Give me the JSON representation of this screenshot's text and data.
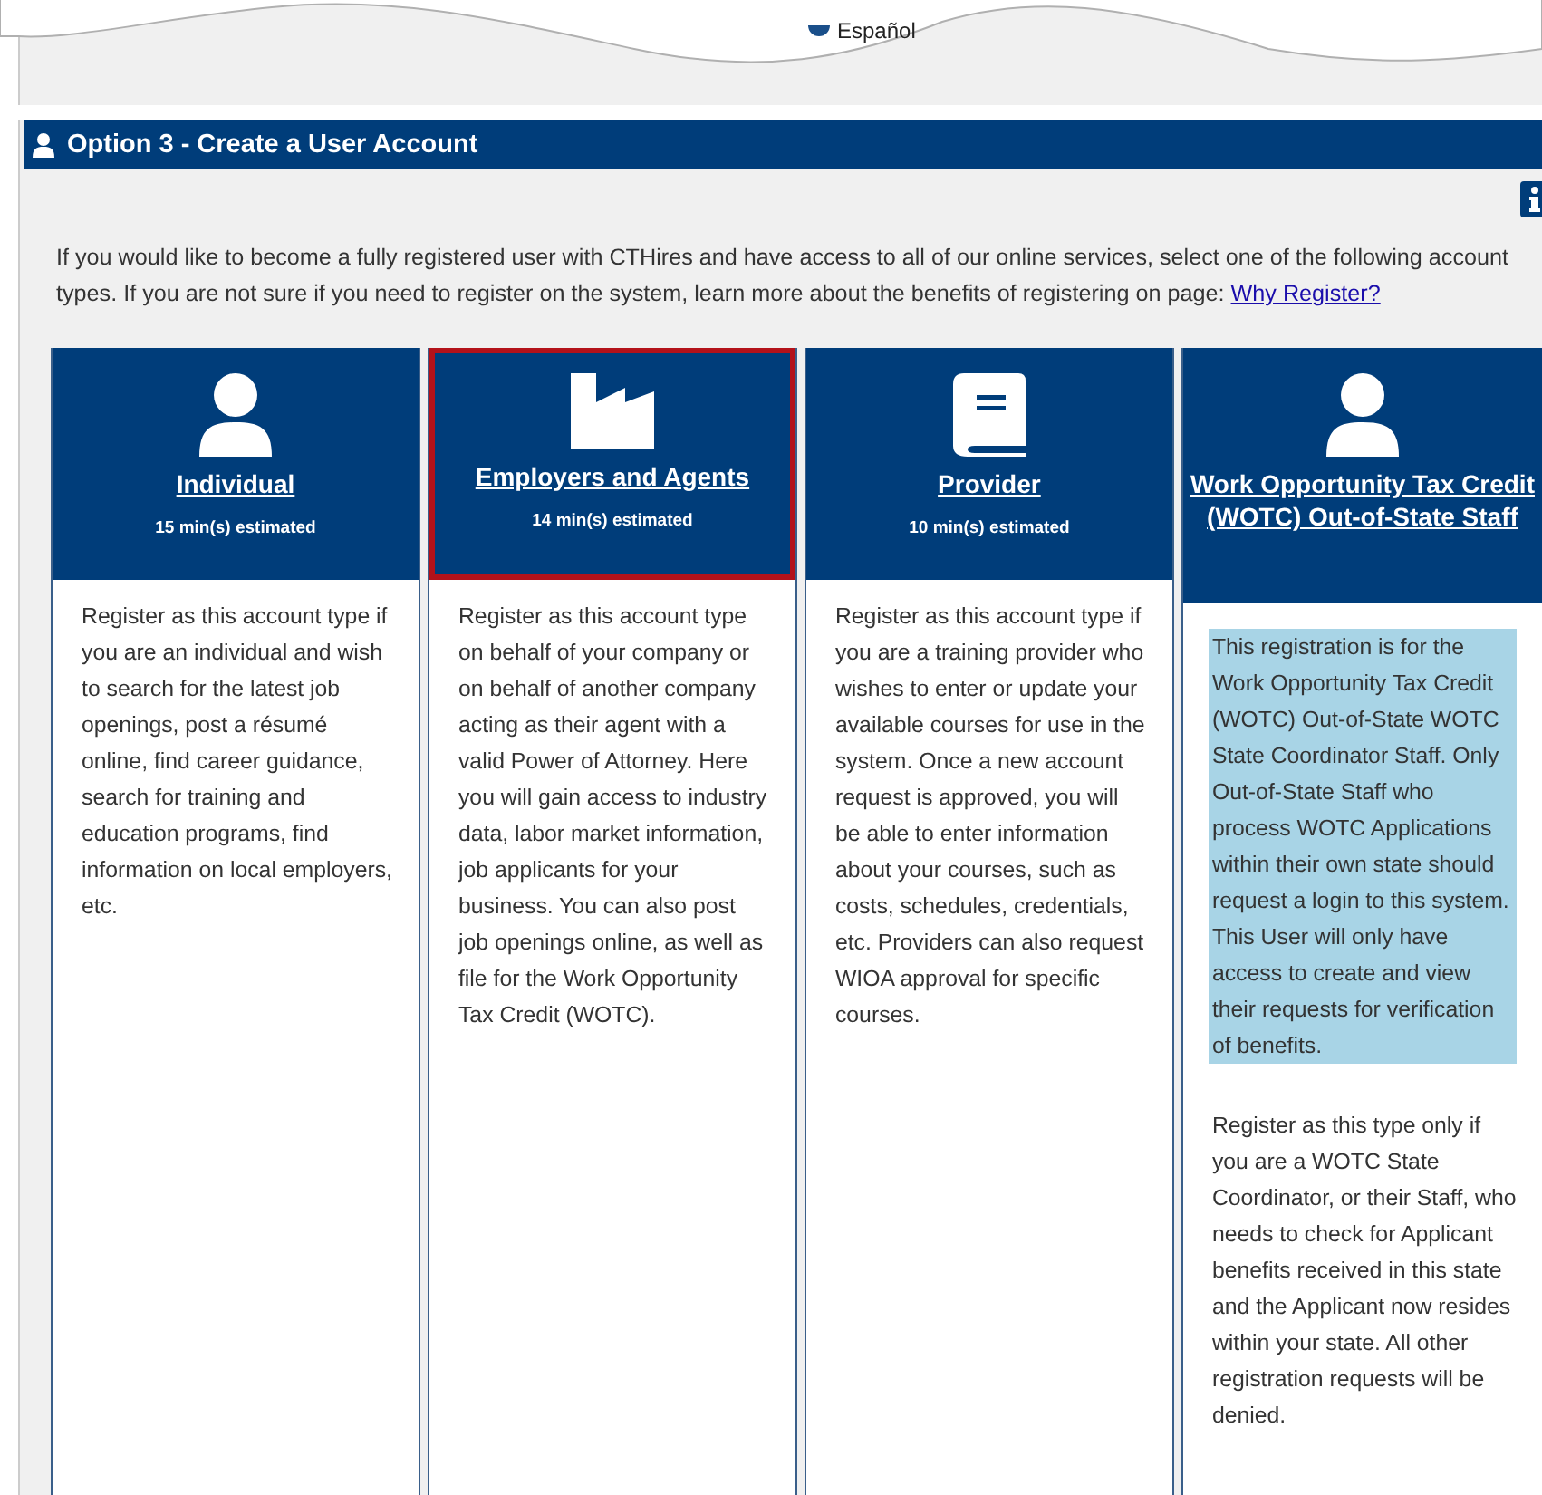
{
  "language_link": {
    "label": "Español"
  },
  "section": {
    "title": "Option 3 - Create a User Account",
    "intro": "If you would like to become a fully registered user with CTHires and have access to all of our online services, select one of the following account types. If you are not sure if you need to register on the system, learn more about the benefits of registering on page: ",
    "intro_link": "Why Register?"
  },
  "cards": [
    {
      "kind": "individual",
      "title": "Individual",
      "estimate": "15 min(s) estimated",
      "selected": false,
      "paragraphs": [
        {
          "text": "Register as this account type if you are an individual and wish to search for the latest job openings, post a résumé online, find career guidance, search for training and education programs, find information on local employers, etc.",
          "highlighted": false
        }
      ]
    },
    {
      "kind": "employer",
      "title": "Employers and Agents",
      "estimate": "14 min(s) estimated",
      "selected": true,
      "paragraphs": [
        {
          "text": "Register as this account type on behalf of your company or on behalf of another company acting as their agent with a valid Power of Attorney. Here you will gain access to industry data, labor market information, job applicants for your business. You can also post job openings online, as well as file for the Work Opportunity Tax Credit (WOTC).",
          "highlighted": false
        }
      ]
    },
    {
      "kind": "provider",
      "title": "Provider",
      "estimate": "10 min(s) estimated",
      "selected": false,
      "paragraphs": [
        {
          "text": "Register as this account type if you are a training provider who wishes to enter or update your available courses for use in the system. Once a new account request is approved, you will be able to enter information about your courses, such as costs, schedules, credentials, etc. Providers can also request WIOA approval for specific courses.",
          "highlighted": false
        }
      ]
    },
    {
      "kind": "staff",
      "title": "Work Opportunity Tax Credit (WOTC) Out-of-State Staff",
      "selected": false,
      "paragraphs": [
        {
          "text": "This registration is for the Work Opportunity Tax Credit (WOTC) Out-of-State WOTC State Coordinator Staff. Only Out-of-State Staff who process WOTC Applications within their own state should request a login to this system. This User will only have access to create and view their requests for verification of benefits.",
          "highlighted": true
        },
        {
          "text": "Register as this type only if you are a WOTC State Coordinator, or their Staff, who needs to check for Applicant benefits received in this state and the Applicant now resides within your state. All other registration requests will be denied.",
          "highlighted": false
        }
      ]
    }
  ]
}
